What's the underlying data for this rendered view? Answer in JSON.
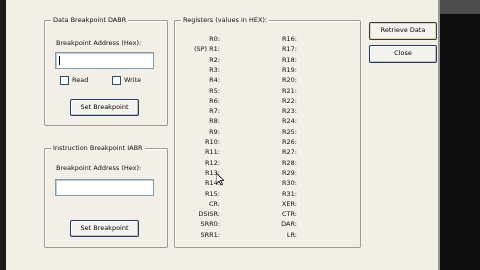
{
  "data_breakpoint": {
    "legend": "Data Breakpoint DABR",
    "address_label": "Breakpoint Address (Hex):",
    "address_value": "",
    "read_label": "Read",
    "write_label": "Write",
    "set_button": "Set Breakpoint"
  },
  "instruction_breakpoint": {
    "legend": "Instruction Breakpoint IABR",
    "address_label": "Breakpoint Address (Hex):",
    "address_value": "",
    "set_button": "Set Breakpoint"
  },
  "registers": {
    "legend": "Registers (values in HEX):",
    "left": [
      "R0:",
      "(SP) R1:",
      "R2:",
      "R3:",
      "R4:",
      "R5:",
      "R6:",
      "R7:",
      "R8:",
      "R9:",
      "R10:",
      "R11:",
      "R12:",
      "R13:",
      "R14:",
      "R15:",
      "CR:",
      "DSISR:",
      "SRR0:",
      "SRR1:"
    ],
    "right": [
      "R16:",
      "R17:",
      "R18:",
      "R19:",
      "R20:",
      "R21:",
      "R22:",
      "R23:",
      "R24:",
      "R25:",
      "R26:",
      "R27:",
      "R28:",
      "R29:",
      "R30:",
      "R31:",
      "XER:",
      "CTR:",
      "DAR:",
      "LR:"
    ]
  },
  "actions": {
    "retrieve": "Retrieve Data",
    "close": "Close"
  }
}
